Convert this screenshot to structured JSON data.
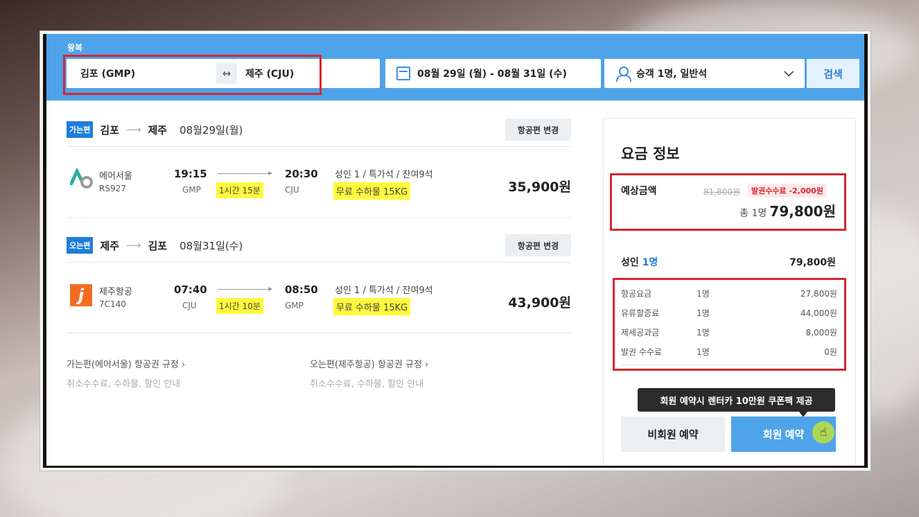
{
  "search": {
    "trip_type": "왕복",
    "from": "김포 (GMP)",
    "swap_icon": "↔",
    "to": "제주 (CJU)",
    "dates": "08월 29일 (월)  -  08월 31일 (수)",
    "passengers": "승객 1명, 일반석",
    "chevron": "⌄",
    "search_label": "검색"
  },
  "outbound": {
    "tag": "가는편",
    "from": "김포",
    "arrow": "⟶",
    "to": "제주",
    "date": "08월29일(월)",
    "change_label": "항공편 변경",
    "airline": "에어서울",
    "flight_no": "RS927",
    "dep_time": "19:15",
    "dep_code": "GMP",
    "duration": "1시간 15분",
    "arr_time": "20:30",
    "arr_code": "CJU",
    "seat_info": "성인 1 / 특가석 / 잔여9석",
    "baggage": "무료 수하물 15KG",
    "price": "35,900원"
  },
  "inbound": {
    "tag": "오는편",
    "from": "제주",
    "arrow": "⟶",
    "to": "김포",
    "date": "08월31일(수)",
    "change_label": "항공편 변경",
    "airline": "제주항공",
    "logo_letter": "j",
    "flight_no": "7C140",
    "dep_time": "07:40",
    "dep_code": "CJU",
    "duration": "1시간 10분",
    "arr_time": "08:50",
    "arr_code": "GMP",
    "seat_info": "성인 1 / 특가석 / 잔여9석",
    "baggage": "무료 수하물 15KG",
    "price": "43,900원"
  },
  "rules": {
    "outbound_title": "가는편(에어서울) 항공권 규정  ›",
    "outbound_sub": "취소수수료, 수하물, 할인 안내",
    "inbound_title": "오는편(제주항공) 항공권 규정  ›",
    "inbound_sub": "취소수수료, 수하물, 할인 안내"
  },
  "fare": {
    "title": "요금 정보",
    "estimate_label": "예상금액",
    "original_price": "81,800원",
    "fee_discount": "발권수수료 -2,000원",
    "total_prefix": "총 1명",
    "total_price": "79,800원",
    "adult_label": "성인",
    "adult_count": "1명",
    "adult_total": "79,800원",
    "breakdown": [
      {
        "name": "항공요금",
        "qty": "1명",
        "value": "27,800원"
      },
      {
        "name": "유류할증료",
        "qty": "1명",
        "value": "44,000원"
      },
      {
        "name": "제세공과금",
        "qty": "1명",
        "value": "8,000원"
      },
      {
        "name": "발권 수수료",
        "qty": "1명",
        "value": "0원"
      }
    ],
    "tooltip": "회원 예약시 렌터카 10만원 쿠폰팩 제공",
    "guest_button": "비회원 예약",
    "member_button": "회원 예약",
    "cursor_icon": "☝"
  }
}
